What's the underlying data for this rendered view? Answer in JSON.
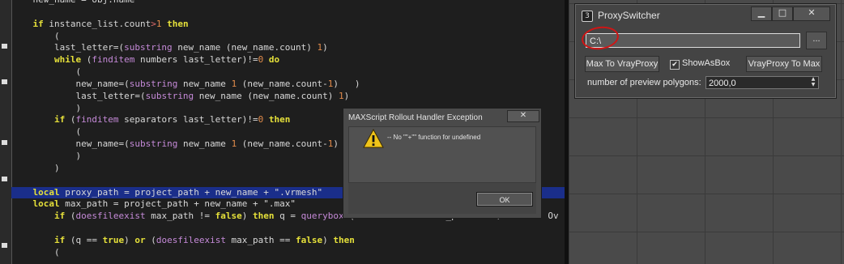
{
  "code_editor": {
    "lines": [
      {
        "indent": "    ",
        "tokens": [
          {
            "t": "new_name = obj.name",
            "c": "plain"
          }
        ]
      },
      {
        "indent": "",
        "tokens": []
      },
      {
        "indent": "    ",
        "tokens": [
          {
            "t": "if",
            "c": "kw"
          },
          {
            "t": " instance_list.count",
            "c": "plain"
          },
          {
            "t": ">",
            "c": "op"
          },
          {
            "t": "1",
            "c": "num"
          },
          {
            "t": " then",
            "c": "kw"
          }
        ]
      },
      {
        "indent": "        ",
        "tokens": [
          {
            "t": "(",
            "c": "plain"
          }
        ]
      },
      {
        "indent": "        ",
        "tokens": [
          {
            "t": "last_letter=(",
            "c": "plain"
          },
          {
            "t": "substring",
            "c": "fn"
          },
          {
            "t": " new_name (new_name.count) ",
            "c": "plain"
          },
          {
            "t": "1",
            "c": "num"
          },
          {
            "t": ")",
            "c": "plain"
          }
        ]
      },
      {
        "indent": "        ",
        "tokens": [
          {
            "t": "while",
            "c": "kw"
          },
          {
            "t": " (",
            "c": "plain"
          },
          {
            "t": "finditem",
            "c": "fn"
          },
          {
            "t": " numbers last_letter)!=",
            "c": "plain"
          },
          {
            "t": "0",
            "c": "num"
          },
          {
            "t": " do",
            "c": "kw"
          }
        ]
      },
      {
        "indent": "            ",
        "tokens": [
          {
            "t": "(",
            "c": "plain"
          }
        ]
      },
      {
        "indent": "            ",
        "tokens": [
          {
            "t": "new_name=(",
            "c": "plain"
          },
          {
            "t": "substring",
            "c": "fn"
          },
          {
            "t": " new_name ",
            "c": "plain"
          },
          {
            "t": "1",
            "c": "num"
          },
          {
            "t": " (new_name.count-",
            "c": "plain"
          },
          {
            "t": "1",
            "c": "num"
          },
          {
            "t": ")   )",
            "c": "plain"
          }
        ]
      },
      {
        "indent": "            ",
        "tokens": [
          {
            "t": "last_letter=(",
            "c": "plain"
          },
          {
            "t": "substring",
            "c": "fn"
          },
          {
            "t": " new_name (new_name.count) ",
            "c": "plain"
          },
          {
            "t": "1",
            "c": "num"
          },
          {
            "t": ")",
            "c": "plain"
          }
        ]
      },
      {
        "indent": "            ",
        "tokens": [
          {
            "t": ")",
            "c": "plain"
          }
        ]
      },
      {
        "indent": "        ",
        "tokens": [
          {
            "t": "if",
            "c": "kw"
          },
          {
            "t": " (",
            "c": "plain"
          },
          {
            "t": "finditem",
            "c": "fn"
          },
          {
            "t": " separators last_letter)!=",
            "c": "plain"
          },
          {
            "t": "0",
            "c": "num"
          },
          {
            "t": " then",
            "c": "kw"
          }
        ]
      },
      {
        "indent": "            ",
        "tokens": [
          {
            "t": "(",
            "c": "plain"
          }
        ]
      },
      {
        "indent": "            ",
        "tokens": [
          {
            "t": "new_name=(",
            "c": "plain"
          },
          {
            "t": "substring",
            "c": "fn"
          },
          {
            "t": " new_name ",
            "c": "plain"
          },
          {
            "t": "1",
            "c": "num"
          },
          {
            "t": " (new_name.count-",
            "c": "plain"
          },
          {
            "t": "1",
            "c": "num"
          },
          {
            "t": ")",
            "c": "plain"
          }
        ]
      },
      {
        "indent": "            ",
        "tokens": [
          {
            "t": ")",
            "c": "plain"
          }
        ]
      },
      {
        "indent": "        ",
        "tokens": [
          {
            "t": ")",
            "c": "plain"
          }
        ]
      },
      {
        "indent": "",
        "tokens": []
      },
      {
        "indent": "    ",
        "hl": true,
        "tokens": [
          {
            "t": "local",
            "c": "kw"
          },
          {
            "t": " proxy_path = project_path + new_name + ",
            "c": "plain"
          },
          {
            "t": "\".vrmesh\"",
            "c": "str"
          }
        ]
      },
      {
        "indent": "    ",
        "tokens": [
          {
            "t": "local",
            "c": "kw"
          },
          {
            "t": " max_path = project_path + new_name + ",
            "c": "plain"
          },
          {
            "t": "\".max\"",
            "c": "str"
          }
        ]
      },
      {
        "indent": "        ",
        "tokens": [
          {
            "t": "if",
            "c": "kw"
          },
          {
            "t": " (",
            "c": "plain"
          },
          {
            "t": "doesfileexist",
            "c": "fn"
          },
          {
            "t": " max_path != ",
            "c": "plain"
          },
          {
            "t": "false",
            "c": "kw"
          },
          {
            "t": ") ",
            "c": "plain"
          },
          {
            "t": "then",
            "c": "kw"
          },
          {
            "t": " q = ",
            "c": "plain"
          },
          {
            "t": "querybox",
            "c": "fn"
          },
          {
            "t": " (",
            "c": "plain"
          },
          {
            "t": "\"filename: \"",
            "c": "str"
          },
          {
            "t": "+ max_path + ",
            "c": "plain"
          },
          {
            "t": "\"\\nexists. Ov",
            "c": "str"
          }
        ]
      },
      {
        "indent": "",
        "tokens": []
      },
      {
        "indent": "        ",
        "tokens": [
          {
            "t": "if",
            "c": "kw"
          },
          {
            "t": " (q == ",
            "c": "plain"
          },
          {
            "t": "true",
            "c": "kw"
          },
          {
            "t": ") ",
            "c": "plain"
          },
          {
            "t": "or",
            "c": "kw"
          },
          {
            "t": " (",
            "c": "plain"
          },
          {
            "t": "doesfileexist",
            "c": "fn"
          },
          {
            "t": " max_path == ",
            "c": "plain"
          },
          {
            "t": "false",
            "c": "kw"
          },
          {
            "t": ") ",
            "c": "plain"
          },
          {
            "t": "then",
            "c": "kw"
          }
        ]
      },
      {
        "indent": "        ",
        "tokens": [
          {
            "t": "(",
            "c": "plain"
          }
        ]
      }
    ]
  },
  "proxy_switcher": {
    "title": "ProxySwitcher",
    "icon": "3ds-max-icon",
    "minimize_label": "▁",
    "maximize_label": "□",
    "close_label": "✕",
    "path_value": "C:\\",
    "browse_label": "...",
    "max_to_vray_label": "Max To VrayProxy",
    "show_as_box_label": "ShowAsBox",
    "show_as_box_checked": "✔",
    "vray_to_max_label": "VrayProxy To Max",
    "preview_polygons_label": "number of preview polygons:",
    "preview_polygons_value": "2000,0",
    "spinner_label": "▲▼"
  },
  "error_dialog": {
    "title": "MAXScript Rollout Handler Exception",
    "close_label": "✕",
    "message": "-- No \"\"+\"\" function for undefined",
    "ok_label": "OK",
    "warning_icon": "warning-icon"
  },
  "colors": {
    "keyword": "#e5e03a",
    "function": "#c58ad8",
    "number": "#e08a4a",
    "selection": "#1a2e8a",
    "annotation_circle": "#d01515"
  }
}
